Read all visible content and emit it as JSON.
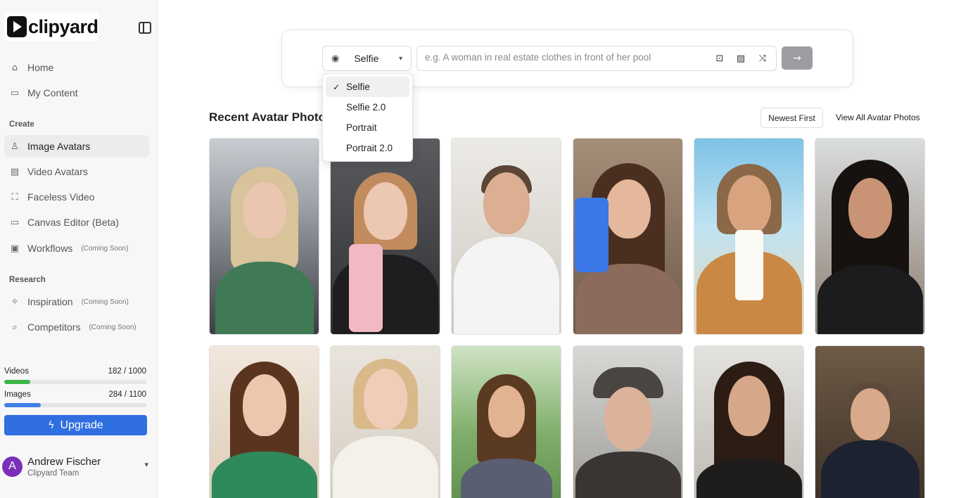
{
  "brand": {
    "name": "clipyard"
  },
  "nav": {
    "main": [
      {
        "label": "Home",
        "icon": "home-icon"
      },
      {
        "label": "My Content",
        "icon": "video-camera-icon"
      }
    ],
    "create_label": "Create",
    "create": [
      {
        "label": "Image Avatars",
        "icon": "user-icon",
        "active": true
      },
      {
        "label": "Video Avatars",
        "icon": "film-icon"
      },
      {
        "label": "Faceless Video",
        "icon": "scan-icon"
      },
      {
        "label": "Canvas Editor (Beta)",
        "icon": "monitor-icon"
      },
      {
        "label": "Workflows",
        "icon": "chip-icon",
        "badge": "(Coming Soon)"
      }
    ],
    "research_label": "Research",
    "research": [
      {
        "label": "Inspiration",
        "icon": "sparkles-icon",
        "badge": "(Coming Soon)"
      },
      {
        "label": "Competitors",
        "icon": "search-icon",
        "badge": "(Coming Soon)"
      }
    ]
  },
  "usage": {
    "videos": {
      "label": "Videos",
      "value": "182 / 1000",
      "fraction": 0.182,
      "color": "#3cb54a"
    },
    "images": {
      "label": "Images",
      "value": "284 / 1100",
      "fraction": 0.258,
      "color": "#3f7fe6"
    }
  },
  "upgrade_label": "Upgrade",
  "user": {
    "initial": "A",
    "name": "Andrew Fischer",
    "team": "Clipyard Team"
  },
  "prompt": {
    "style_selected": "Selfie",
    "placeholder": "e.g. A woman in real estate clothes in front of her pool",
    "icons": [
      "shopping-bag-icon",
      "image-icon",
      "shuffle-icon"
    ]
  },
  "style_options": [
    "Selfie",
    "Selfie 2.0",
    "Portrait",
    "Portrait 2.0"
  ],
  "gallery": {
    "title": "Recent Avatar Photos",
    "sort_label": "Newest First",
    "view_all_label": "View All Avatar Photos"
  },
  "colors": {
    "accent": "#2f6fe0",
    "avatar": "#7a2fb8"
  }
}
